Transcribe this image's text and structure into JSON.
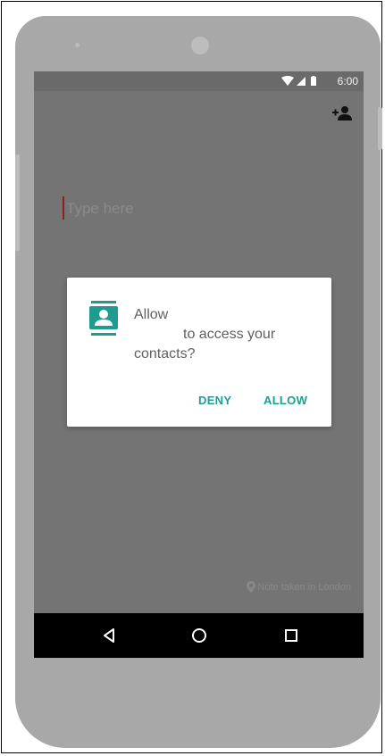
{
  "status_bar": {
    "time": "6:00",
    "icons": [
      "wifi-icon",
      "signal-icon",
      "battery-icon"
    ]
  },
  "toolbar": {
    "action_icon": "add-person-icon"
  },
  "editor": {
    "placeholder": "Type here"
  },
  "footer": {
    "location_text": "Note taken in London"
  },
  "dialog": {
    "icon": "contacts-icon",
    "message_line1": "Allow",
    "message_line2": "to access your",
    "message_line3": "contacts?",
    "deny_label": "DENY",
    "allow_label": "ALLOW"
  },
  "nav_bar": {
    "buttons": [
      "back-icon",
      "home-icon",
      "recents-icon"
    ]
  },
  "colors": {
    "accent": "#1f9c8f",
    "scrim": "#747474",
    "cursor": "#8b2323"
  }
}
